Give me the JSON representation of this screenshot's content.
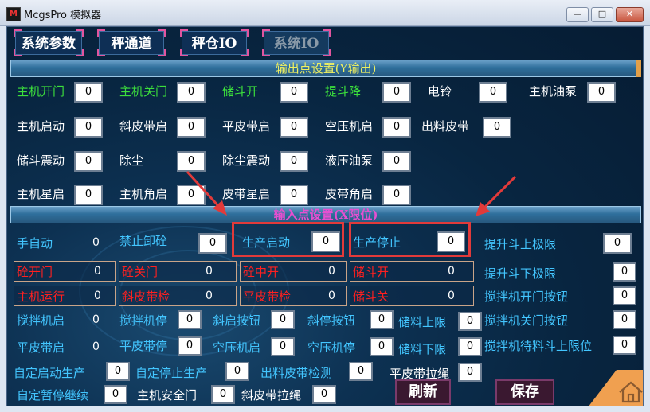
{
  "window": {
    "title": "McgsPro 模拟器",
    "app_icon_glyph": "M",
    "min": "—",
    "max": "□",
    "close": "✕"
  },
  "tabs": [
    "系统参数",
    "秤通道",
    "秤仓IO",
    "系统IO"
  ],
  "output_section": {
    "title": "输出点设置(Y输出)",
    "rows": [
      [
        {
          "label": "主机开门",
          "value": "0",
          "color": "green"
        },
        {
          "label": "主机关门",
          "value": "0",
          "color": "green"
        },
        {
          "label": "储斗开",
          "value": "0",
          "color": "green"
        },
        {
          "label": "提斗降",
          "value": "0",
          "color": "green"
        },
        {
          "label": "电铃",
          "value": "0",
          "color": "white"
        },
        {
          "label": "主机油泵",
          "value": "0",
          "color": "white"
        }
      ],
      [
        {
          "label": "主机启动",
          "value": "0"
        },
        {
          "label": "斜皮带启",
          "value": "0"
        },
        {
          "label": "平皮带启",
          "value": "0"
        },
        {
          "label": "空压机启",
          "value": "0"
        },
        {
          "label": "出料皮带",
          "value": "0"
        }
      ],
      [
        {
          "label": "储斗震动",
          "value": "0"
        },
        {
          "label": "除尘",
          "value": "0"
        },
        {
          "label": "除尘震动",
          "value": "0"
        },
        {
          "label": "液压油泵",
          "value": "0"
        }
      ],
      [
        {
          "label": "主机星启",
          "value": "0"
        },
        {
          "label": "主机角启",
          "value": "0"
        },
        {
          "label": "皮带星启",
          "value": "0"
        },
        {
          "label": "皮带角启",
          "value": "0"
        }
      ]
    ]
  },
  "input_section": {
    "title": "输入点设置(X限位)",
    "row1": [
      {
        "label": "手自动",
        "value": "0"
      },
      {
        "label": "禁止卸砼",
        "value": "0"
      },
      {
        "label": "生产启动",
        "value": "0"
      },
      {
        "label": "生产停止",
        "value": "0"
      },
      {
        "label": "提升斗上极限",
        "value": "0"
      }
    ],
    "alarm_row1": [
      {
        "label": "砼开门",
        "value": "0"
      },
      {
        "label": "砼关门",
        "value": "0"
      },
      {
        "label": "砼中开",
        "value": "0"
      },
      {
        "label": "储斗开",
        "value": "0"
      }
    ],
    "alarm_row2": [
      {
        "label": "主机运行",
        "value": "0"
      },
      {
        "label": "斜皮带检",
        "value": "0"
      },
      {
        "label": "平皮带检",
        "value": "0"
      },
      {
        "label": "储斗关",
        "value": "0"
      }
    ],
    "right_col": [
      {
        "label": "提升斗下极限",
        "value": "0"
      },
      {
        "label": "搅拌机开门按钮",
        "value": "0"
      },
      {
        "label": "搅拌机关门按钮",
        "value": "0"
      },
      {
        "label": "搅拌机待料斗上限位",
        "value": "0"
      }
    ],
    "row_a": [
      {
        "label": "搅拌机启",
        "value": "0"
      },
      {
        "label": "搅拌机停",
        "value": "0"
      },
      {
        "label": "斜启按钮",
        "value": "0"
      },
      {
        "label": "斜停按钮",
        "value": "0"
      },
      {
        "label": "储料上限",
        "value": "0"
      }
    ],
    "row_b": [
      {
        "label": "平皮带启",
        "value": "0"
      },
      {
        "label": "平皮带停",
        "value": "0"
      },
      {
        "label": "空压机启",
        "value": "0"
      },
      {
        "label": "空压机停",
        "value": "0"
      },
      {
        "label": "储料下限",
        "value": "0"
      }
    ],
    "row_c": [
      {
        "label": "自定启动生产",
        "value": "0"
      },
      {
        "label": "自定停止生产",
        "value": "0"
      },
      {
        "label": "出料皮带检测",
        "value": "0"
      },
      {
        "label": "平皮带拉绳",
        "value": "0"
      }
    ],
    "row_d": [
      {
        "label": "自定暂停继续",
        "value": "0"
      },
      {
        "label": "主机安全门",
        "value": "0"
      },
      {
        "label": "斜皮带拉绳",
        "value": "0"
      }
    ]
  },
  "buttons": {
    "refresh": "刷新",
    "save": "保存"
  },
  "colors": {
    "green_label": "#3ce03c",
    "cyan_label": "#43c6ff",
    "alarm_text": "#ff2020",
    "section_title_output": "#f0f060",
    "section_title_input": "#e64fd1",
    "highlight": "#e23a3a",
    "home_bg": "#f0a050"
  }
}
